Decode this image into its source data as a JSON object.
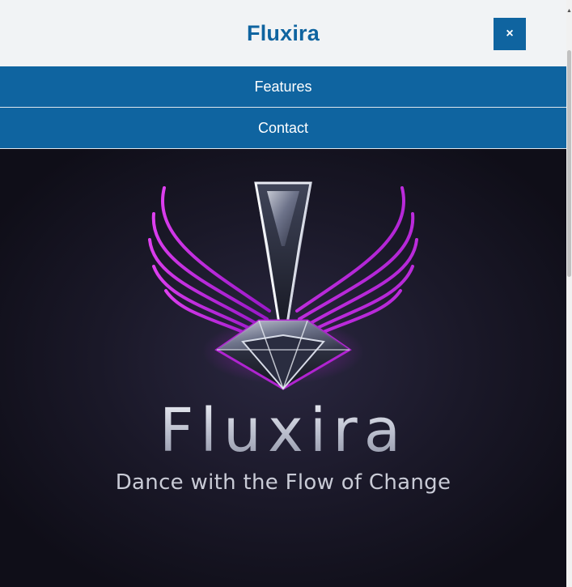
{
  "header": {
    "brand": "Fluxira",
    "close_label": "×"
  },
  "nav": {
    "items": [
      {
        "label": "Features"
      },
      {
        "label": "Contact"
      }
    ]
  },
  "hero": {
    "title": "Fluxira",
    "tagline": "Dance with the Flow of Change"
  },
  "colors": {
    "accent": "#0f64a0",
    "header_bg": "#f1f3f5",
    "hero_bg": "#1a1828",
    "logo_magenta": "#c020d8"
  },
  "icons": {
    "close": "close-icon",
    "logo": "winged-crystal-logo-icon"
  }
}
